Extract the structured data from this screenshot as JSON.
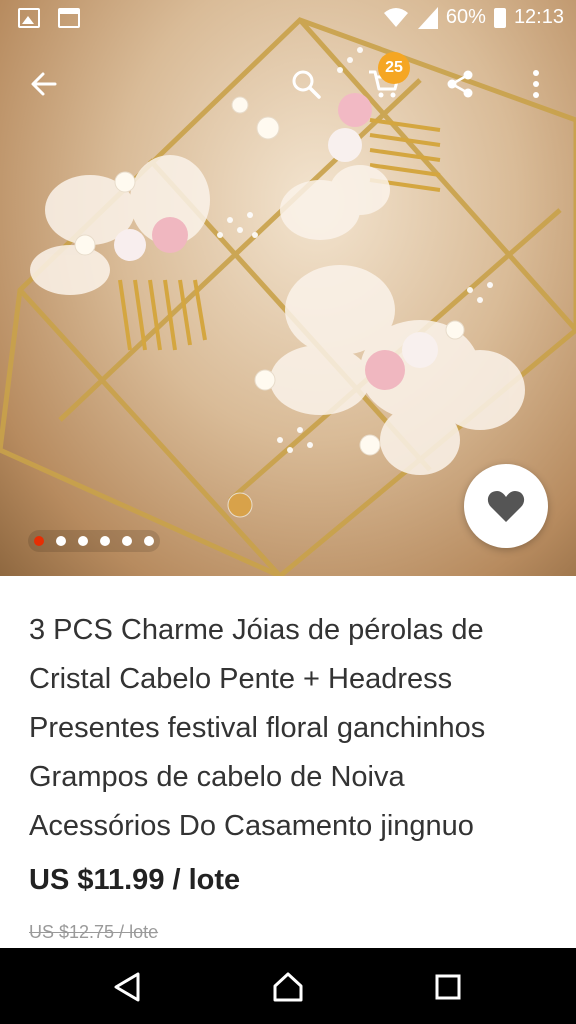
{
  "status_bar": {
    "battery": "60%",
    "time": "12:13",
    "icons": [
      "image-icon",
      "store-icon",
      "wifi-icon",
      "signal-icon",
      "battery-icon"
    ]
  },
  "action_bar": {
    "icons": [
      "back-arrow-icon",
      "search-icon",
      "cart-icon",
      "share-icon",
      "more-vertical-icon"
    ],
    "cart_count": "25"
  },
  "gallery": {
    "total_images": 6,
    "active_index": 0,
    "favorite_icon": "heart-icon"
  },
  "product": {
    "title": "3 PCS Charme Jóias de pérolas de Cristal Cabelo Pente + Headress Presentes festival floral ganchinhos Grampos de cabelo de Noiva Acessórios Do Casamento jingnuo",
    "price": "US $11.99 / lote",
    "original_price": "US $12.75 / lote"
  },
  "nav_bar": {
    "icons": [
      "nav-back-icon",
      "nav-home-icon",
      "nav-recent-icon"
    ]
  },
  "colors": {
    "accent": "#e62e04",
    "badge": "#f5a623",
    "price_text": "#222222",
    "old_price_text": "#9a9a9a"
  }
}
